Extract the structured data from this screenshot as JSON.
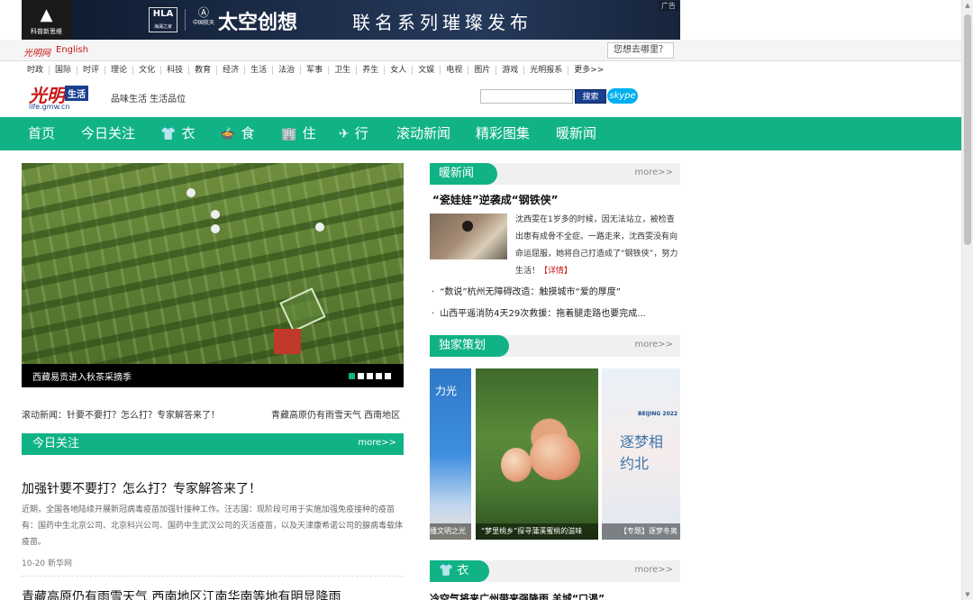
{
  "ad": {
    "brand_small": "科普新思维",
    "hla": "HLA",
    "hla_sub": "海澜之家",
    "space": "中国航天",
    "title": "太空创想",
    "subtitle": "联名系列璀璨发布",
    "tag": "广告"
  },
  "topbar": {
    "site": "光明网",
    "english": "English",
    "where": "您想去哪里？"
  },
  "channels": [
    "时政",
    "国际",
    "时评",
    "理论",
    "文化",
    "科技",
    "教育",
    "经济",
    "生活",
    "法治",
    "军事",
    "卫生",
    "养生",
    "女人",
    "文娱",
    "电视",
    "图片",
    "游戏",
    "光明报系",
    "更多>>"
  ],
  "brand": {
    "gm": "光明",
    "life": "生活",
    "url": "life.gmw.cn",
    "slogan": "品味生活 生活品位"
  },
  "search": {
    "button": "搜索",
    "skype": "skype"
  },
  "mainnav": [
    {
      "label": "首页",
      "icon": ""
    },
    {
      "label": "今日关注",
      "icon": ""
    },
    {
      "label": "衣",
      "icon": "👕"
    },
    {
      "label": "食",
      "icon": "🍲"
    },
    {
      "label": "住",
      "icon": "🏢"
    },
    {
      "label": "行",
      "icon": "✈"
    },
    {
      "label": "滚动新闻",
      "icon": ""
    },
    {
      "label": "精彩图集",
      "icon": ""
    },
    {
      "label": "暖新闻",
      "icon": ""
    }
  ],
  "carousel": {
    "caption": "西藏易贡进入秋茶采摘季",
    "dots": 5,
    "active": 1
  },
  "ticker": {
    "item1": "滚动新闻：针要不要打？怎么打？专家解答来了！",
    "item2": "青藏高原仍有雨雪天气 西南地区"
  },
  "today": {
    "title": "今日关注",
    "more": "more>>",
    "headline": "加强针要不要打？怎么打？专家解答来了！",
    "summary": "近期，全国各地陆续开展新冠病毒疫苗加强针接种工作。汪志国：现阶段可用于实施加强免疫接种的疫苗有：国药中生北京公司、北京科兴公司、国药中生武汉公司的灭活疫苗，以及天津康希诺公司的腺病毒载体疫苗。",
    "meta": "10-20 新华网",
    "headline2": "青藏高原仍有雨雪天气 西南地区江南华南等地有明显降雨"
  },
  "warm": {
    "title": "暖新闻",
    "more": "more>>",
    "headline": "“瓷娃娃”逆袭成“钢铁侠”",
    "text": "沈西雯在1岁多的时候，因无法站立，被检查出患有成骨不全症。一路走来，沈西雯没有向命运屈服，她将自己打造成了“钢铁侠”，努力生活！",
    "detail": "【详情】",
    "list": [
      "“数说”杭州无障碍改造：触摸城市“爱的厚度”",
      "山西平遥消防4天29次救援：拖着腿走路也要完成..."
    ]
  },
  "exclusive": {
    "title": "独家策划",
    "more": "more>>",
    "g1_text": "力光",
    "g1_cap": "播文明之光",
    "g2_cap": "“梦里桃乡”探寻蒲溪蜜桃的滋味",
    "g3_bj": "BEIJING 2022",
    "g3_text": "逐梦相约北",
    "g3_cap": "【专题】逐梦冬奥"
  },
  "clothing": {
    "title": "衣",
    "more": "more>>",
    "headline": "冷空气将来广州带来强降雨 羊城“口渴”"
  }
}
